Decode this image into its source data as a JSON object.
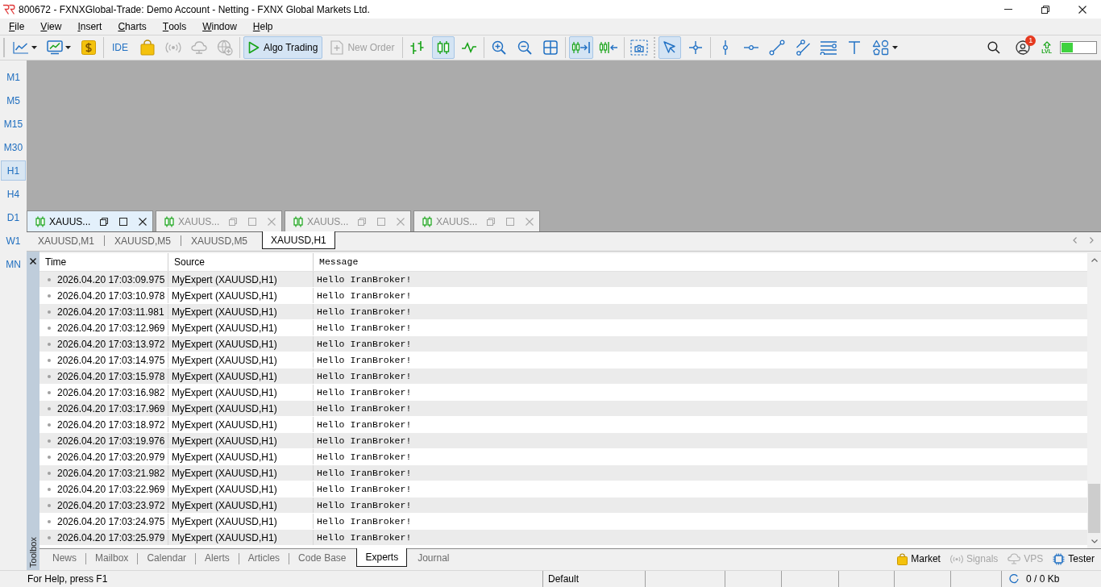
{
  "window": {
    "title": "800672 - FXNXGlobal-Trade: Demo Account - Netting - FXNX Global Markets Ltd."
  },
  "menu": [
    "File",
    "View",
    "Insert",
    "Charts",
    "Tools",
    "Window",
    "Help"
  ],
  "toolbar": {
    "items": [
      {
        "pressed": false,
        "disabled": false
      },
      {
        "pressed": false,
        "disabled": false
      },
      {
        "pressed": false,
        "disabled": false
      },
      {
        "label": "IDE",
        "pressed": false,
        "disabled": false
      },
      {
        "pressed": false,
        "disabled": false
      },
      {
        "pressed": false,
        "disabled": true
      },
      {
        "pressed": false,
        "disabled": true
      },
      {
        "pressed": false,
        "disabled": true
      },
      {
        "label": "Algo Trading",
        "pressed": true,
        "disabled": false
      },
      {
        "label": "New Order",
        "pressed": false,
        "disabled": true
      },
      {
        "pressed": false,
        "disabled": false
      },
      {
        "pressed": true,
        "disabled": false
      },
      {
        "pressed": false,
        "disabled": false
      },
      {
        "pressed": false,
        "disabled": false
      },
      {
        "pressed": false,
        "disabled": false
      },
      {
        "pressed": false,
        "disabled": false
      },
      {
        "pressed": true,
        "disabled": false
      },
      {
        "pressed": false,
        "disabled": false
      },
      {
        "pressed": false,
        "disabled": false
      },
      {
        "pressed": true,
        "disabled": false
      },
      {
        "pressed": false,
        "disabled": false
      },
      {
        "pressed": false,
        "disabled": false
      },
      {
        "pressed": false,
        "disabled": false
      },
      {
        "pressed": false,
        "disabled": false
      },
      {
        "pressed": false,
        "disabled": false
      },
      {
        "pressed": false,
        "disabled": false
      },
      {
        "pressed": false,
        "disabled": false
      },
      {
        "pressed": false,
        "disabled": false
      }
    ],
    "notification_count": "1",
    "level_label": "LVL"
  },
  "timeframes": [
    {
      "label": "M1",
      "selected": false
    },
    {
      "label": "M5",
      "selected": false
    },
    {
      "label": "M15",
      "selected": false
    },
    {
      "label": "M30",
      "selected": false
    },
    {
      "label": "H1",
      "selected": true
    },
    {
      "label": "H4",
      "selected": false
    },
    {
      "label": "D1",
      "selected": false
    },
    {
      "label": "W1",
      "selected": false
    },
    {
      "label": "MN",
      "selected": false
    }
  ],
  "chart_tabs": [
    {
      "title": "XAUUS...",
      "selected": true
    },
    {
      "title": "XAUUS...",
      "selected": false
    },
    {
      "title": "XAUUS...",
      "selected": false
    },
    {
      "title": "XAUUS...",
      "selected": false
    }
  ],
  "chart_subtabs": [
    {
      "label": "XAUUSD,M1",
      "selected": false
    },
    {
      "label": "XAUUSD,M5",
      "selected": false
    },
    {
      "label": "XAUUSD,M5",
      "selected": false
    },
    {
      "label": "XAUUSD,H1",
      "selected": true
    }
  ],
  "toolbox": {
    "title": "Toolbox",
    "table": {
      "columns": [
        "Time",
        "Source",
        "Message"
      ],
      "rows": [
        {
          "time": "2026.04.20 17:03:09.975",
          "source": "MyExpert (XAUUSD,H1)",
          "message": "Hello IranBroker!"
        },
        {
          "time": "2026.04.20 17:03:10.978",
          "source": "MyExpert (XAUUSD,H1)",
          "message": "Hello IranBroker!"
        },
        {
          "time": "2026.04.20 17:03:11.981",
          "source": "MyExpert (XAUUSD,H1)",
          "message": "Hello IranBroker!"
        },
        {
          "time": "2026.04.20 17:03:12.969",
          "source": "MyExpert (XAUUSD,H1)",
          "message": "Hello IranBroker!"
        },
        {
          "time": "2026.04.20 17:03:13.972",
          "source": "MyExpert (XAUUSD,H1)",
          "message": "Hello IranBroker!"
        },
        {
          "time": "2026.04.20 17:03:14.975",
          "source": "MyExpert (XAUUSD,H1)",
          "message": "Hello IranBroker!"
        },
        {
          "time": "2026.04.20 17:03:15.978",
          "source": "MyExpert (XAUUSD,H1)",
          "message": "Hello IranBroker!"
        },
        {
          "time": "2026.04.20 17:03:16.982",
          "source": "MyExpert (XAUUSD,H1)",
          "message": "Hello IranBroker!"
        },
        {
          "time": "2026.04.20 17:03:17.969",
          "source": "MyExpert (XAUUSD,H1)",
          "message": "Hello IranBroker!"
        },
        {
          "time": "2026.04.20 17:03:18.972",
          "source": "MyExpert (XAUUSD,H1)",
          "message": "Hello IranBroker!"
        },
        {
          "time": "2026.04.20 17:03:19.976",
          "source": "MyExpert (XAUUSD,H1)",
          "message": "Hello IranBroker!"
        },
        {
          "time": "2026.04.20 17:03:20.979",
          "source": "MyExpert (XAUUSD,H1)",
          "message": "Hello IranBroker!"
        },
        {
          "time": "2026.04.20 17:03:21.982",
          "source": "MyExpert (XAUUSD,H1)",
          "message": "Hello IranBroker!"
        },
        {
          "time": "2026.04.20 17:03:22.969",
          "source": "MyExpert (XAUUSD,H1)",
          "message": "Hello IranBroker!"
        },
        {
          "time": "2026.04.20 17:03:23.972",
          "source": "MyExpert (XAUUSD,H1)",
          "message": "Hello IranBroker!"
        },
        {
          "time": "2026.04.20 17:03:24.975",
          "source": "MyExpert (XAUUSD,H1)",
          "message": "Hello IranBroker!"
        },
        {
          "time": "2026.04.20 17:03:25.979",
          "source": "MyExpert (XAUUSD,H1)",
          "message": "Hello IranBroker!"
        }
      ]
    },
    "tabs": [
      {
        "label": "News",
        "selected": false
      },
      {
        "label": "Mailbox",
        "selected": false
      },
      {
        "label": "Calendar",
        "selected": false
      },
      {
        "label": "Alerts",
        "selected": false
      },
      {
        "label": "Articles",
        "selected": false
      },
      {
        "label": "Code Base",
        "selected": false
      },
      {
        "label": "Experts",
        "selected": true
      },
      {
        "label": "Journal",
        "selected": false
      }
    ],
    "links": [
      {
        "label": "Market",
        "disabled": false
      },
      {
        "label": "Signals",
        "disabled": true
      },
      {
        "label": "VPS",
        "disabled": true
      },
      {
        "label": "Tester",
        "disabled": false
      }
    ]
  },
  "status_bar": {
    "help": "For Help, press F1",
    "profile": "Default",
    "traffic": "0 / 0 Kb"
  }
}
